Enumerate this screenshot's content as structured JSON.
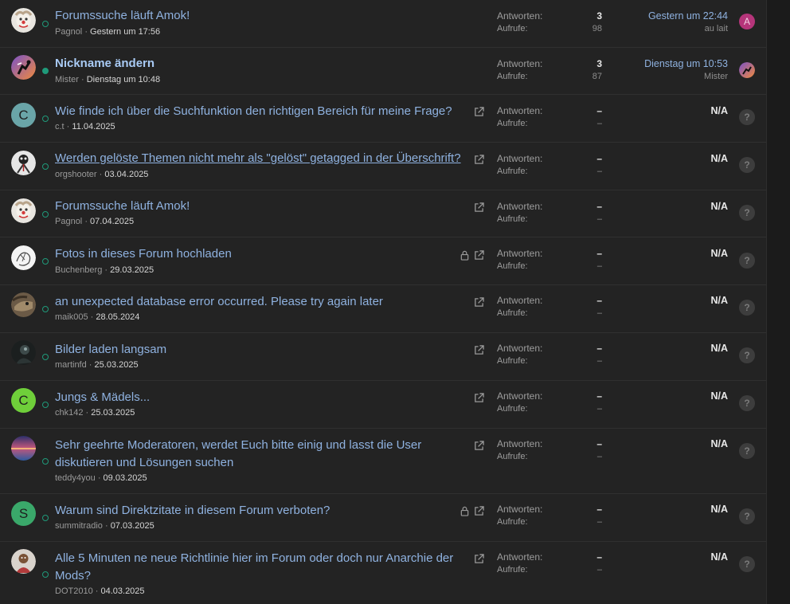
{
  "labels": {
    "replies": "Antworten:",
    "views": "Aufrufe:"
  },
  "colors": {
    "link": "#8fb2e0",
    "unread": "#a9cbf5",
    "status": "#1f9a7a",
    "avatar_a": "#b5357a"
  },
  "threads": [
    {
      "title": "Forumssuche läuft Amok!",
      "author": "Pagnol",
      "date": "Gestern um 17:56",
      "replies": "3",
      "views": "98",
      "last_date": "Gestern um 22:44",
      "last_user": "au lait",
      "avatar": "clown-avatar",
      "mini_avatar_letter": "A"
    },
    {
      "title": "Nickname ändern",
      "author": "Mister",
      "date": "Dienstag um 10:48",
      "replies": "3",
      "views": "87",
      "last_date": "Dienstag um 10:53",
      "last_user": "Mister",
      "avatar": "purple-figure-avatar"
    },
    {
      "title": "Wie finde ich über die Suchfunktion den richtigen Bereich für meine Frage?",
      "author": "c.t",
      "date": "11.04.2025",
      "replies": "–",
      "views": "–",
      "last_date": "N/A",
      "avatar_letter": "C",
      "avatar_color": "#6aa5a8",
      "icons": [
        "external-link-icon"
      ]
    },
    {
      "title": "Werden gelöste Themen nicht mehr als \"gelöst\" getagged in der Überschrift?",
      "author": "orgshooter",
      "date": "03.04.2025",
      "replies": "–",
      "views": "–",
      "last_date": "N/A",
      "avatar": "skull-avatar",
      "icons": [
        "external-link-icon"
      ]
    },
    {
      "title": "Forumssuche läuft Amok!",
      "author": "Pagnol",
      "date": "07.04.2025",
      "replies": "–",
      "views": "–",
      "last_date": "N/A",
      "avatar": "clown-avatar",
      "icons": [
        "external-link-icon"
      ]
    },
    {
      "title": "Fotos in dieses Forum hochladen",
      "author": "Buchenberg",
      "date": "29.03.2025",
      "replies": "–",
      "views": "–",
      "last_date": "N/A",
      "avatar": "sketch-avatar",
      "icons": [
        "lock-icon",
        "external-link-icon"
      ]
    },
    {
      "title": "an unexpected database error occurred. Please try again later",
      "author": "maik005",
      "date": "28.05.2024",
      "replies": "–",
      "views": "–",
      "last_date": "N/A",
      "avatar": "animal-avatar",
      "icons": [
        "external-link-icon"
      ]
    },
    {
      "title": "Bilder laden langsam",
      "author": "martinfd",
      "date": "25.03.2025",
      "replies": "–",
      "views": "–",
      "last_date": "N/A",
      "avatar": "dark-avatar",
      "icons": [
        "external-link-icon"
      ]
    },
    {
      "title": "Jungs & Mädels...",
      "author": "chk142",
      "date": "25.03.2025",
      "replies": "–",
      "views": "–",
      "last_date": "N/A",
      "avatar_letter": "C",
      "avatar_color": "#6fcf3a",
      "icons": [
        "external-link-icon"
      ]
    },
    {
      "title": "Sehr geehrte Moderatoren, werdet Euch bitte einig und lasst die User diskutieren und Lösungen suchen",
      "author": "teddy4you",
      "date": "09.03.2025",
      "replies": "–",
      "views": "–",
      "last_date": "N/A",
      "avatar": "sunset-avatar",
      "icons": [
        "external-link-icon"
      ]
    },
    {
      "title": "Warum sind Direktzitate in diesem Forum verboten?",
      "author": "summitradio",
      "date": "07.03.2025",
      "replies": "–",
      "views": "–",
      "last_date": "N/A",
      "avatar_letter": "S",
      "avatar_color": "#3aa86a",
      "icons": [
        "lock-icon",
        "external-link-icon"
      ]
    },
    {
      "title": "Alle 5 Minuten ne neue Richtlinie hier im Forum oder doch nur Anarchie der Mods?",
      "author": "DOT2010",
      "date": "04.03.2025",
      "replies": "–",
      "views": "–",
      "last_date": "N/A",
      "avatar": "person-avatar",
      "icons": [
        "external-link-icon"
      ]
    }
  ],
  "unknown_user_glyph": "?"
}
